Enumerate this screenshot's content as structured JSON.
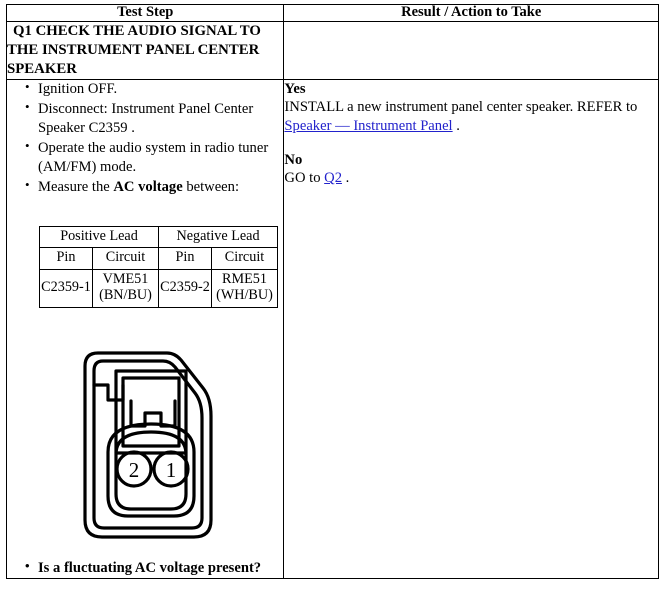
{
  "table": {
    "headers": {
      "test_step": "Test Step",
      "result_action": "Result / Action to Take"
    },
    "q1_title": "Q1 CHECK THE AUDIO SIGNAL TO THE INSTRUMENT PANEL CENTER SPEAKER",
    "q1_title_lines": [
      "Q1 CHECK THE AUDIO SIGNAL TO",
      "THE INSTRUMENT PANEL CENTER",
      "SPEAKER"
    ],
    "steps": [
      {
        "text": "Ignition OFF."
      },
      {
        "text": "Disconnect: Instrument Panel Center Speaker C2359 ."
      },
      {
        "text": "Operate the audio system in radio tuner (AM/FM) mode."
      },
      {
        "prefix": "Measure the ",
        "bold": "AC voltage",
        "suffix": " between:"
      }
    ],
    "question": "Is a fluctuating AC voltage present?"
  },
  "pin_table": {
    "lead_headers": [
      "Positive Lead",
      "Negative Lead"
    ],
    "sub_headers": [
      "Pin",
      "Circuit",
      "Pin",
      "Circuit"
    ],
    "row": [
      "C2359-1",
      "VME51 (BN/BU)",
      "C2359-2",
      "RME51 (WH/BU)"
    ]
  },
  "result": {
    "yes_label": "Yes",
    "yes_text_before": "INSTALL a new instrument panel center speaker. REFER to ",
    "yes_link": "Speaker — Instrument Panel",
    "yes_text_after": " .",
    "no_label": "No",
    "no_text_before": "GO to ",
    "no_link": "Q2",
    "no_text_after": " ."
  },
  "connector": {
    "name": "connector-c2359-diagram",
    "pin_labels": [
      "2",
      "1"
    ],
    "pin_left": "2",
    "pin_right": "1"
  },
  "colors": {
    "link": "#2222cc",
    "border": "#000000",
    "text": "#000000",
    "background": "#ffffff"
  }
}
